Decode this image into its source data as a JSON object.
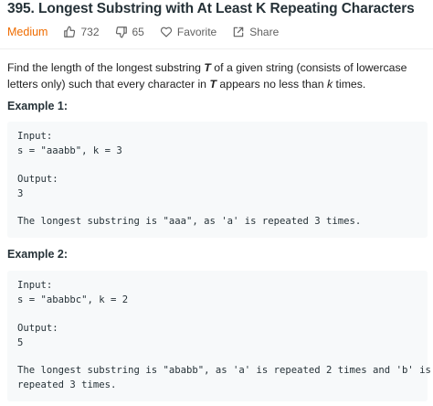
{
  "problem": {
    "title": "395. Longest Substring with At Least K Repeating Characters",
    "difficulty": "Medium",
    "likes": "732",
    "dislikes": "65",
    "favorite_label": "Favorite",
    "share_label": "Share"
  },
  "description": {
    "p1": "Find the length of the longest substring ",
    "T1": "T",
    "p2": " of a given string (consists of lowercase letters only) such that every character in ",
    "T2": "T",
    "p3": " appears no less than ",
    "k": "k",
    "p4": " times."
  },
  "examples": [
    {
      "heading": "Example 1:",
      "input_label": "Input:",
      "input": "s = \"aaabb\", k = 3",
      "output_label": "Output:",
      "output": "3",
      "explanation_lines": [
        "The longest substring is \"aaa\", as 'a' is repeated 3 times."
      ]
    },
    {
      "heading": "Example 2:",
      "input_label": "Input:",
      "input": "s = \"ababbc\", k = 2",
      "output_label": "Output:",
      "output": "5",
      "explanation_lines": [
        "The longest substring is \"ababb\", as 'a' is repeated 2 times and 'b' is",
        "repeated 3 times."
      ]
    }
  ],
  "icons": {
    "like": "thumbs-up-icon",
    "dislike": "thumbs-down-icon",
    "favorite": "heart-icon",
    "share": "share-icon"
  },
  "colors": {
    "difficulty_medium": "#ef6c00",
    "code_background": "#f7f9fa",
    "meta_text": "#616161"
  }
}
